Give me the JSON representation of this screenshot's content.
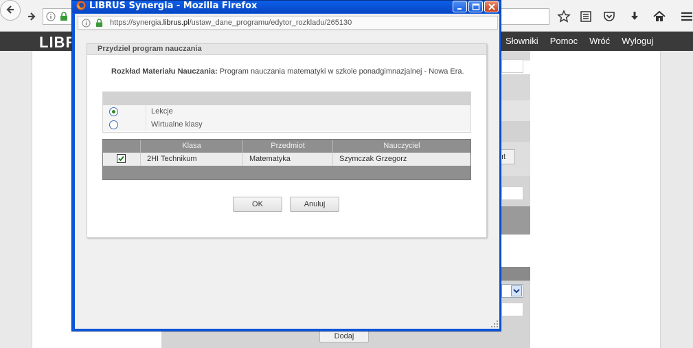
{
  "background_page": {
    "logo": "LIBR",
    "nav_items": [
      "Słowniki",
      "Pomoc",
      "Wróć",
      "Wyloguj"
    ],
    "add_button_label": "Dodaj",
    "partial_button_label": "ıt"
  },
  "popup": {
    "title": "LIBRUS Synergia - Mozilla Firefox",
    "url_prefix": "https://synergia.",
    "url_domain": "librus.pl",
    "url_path": "/ustaw_dane_programu/edytor_rozkladu/265130",
    "dialog": {
      "title": "Przydziel program nauczania",
      "info_label": "Rozkład Materiału Nauczania:",
      "info_value": "Program nauczania matematyki w szkole ponadgimnazjalnej - Nowa Era.",
      "radio_options": [
        {
          "label": "Lekcje",
          "checked": true
        },
        {
          "label": "Wirtualne klasy",
          "checked": false
        }
      ],
      "table": {
        "headers": [
          "Klasa",
          "Przedmiot",
          "Nauczyciel"
        ],
        "rows": [
          {
            "checked": true,
            "klasa": "2HI Technikum",
            "przedmiot": "Matematyka",
            "nauczyciel": "Szymczak Grzegorz"
          }
        ]
      },
      "ok_label": "OK",
      "cancel_label": "Anuluj"
    }
  }
}
